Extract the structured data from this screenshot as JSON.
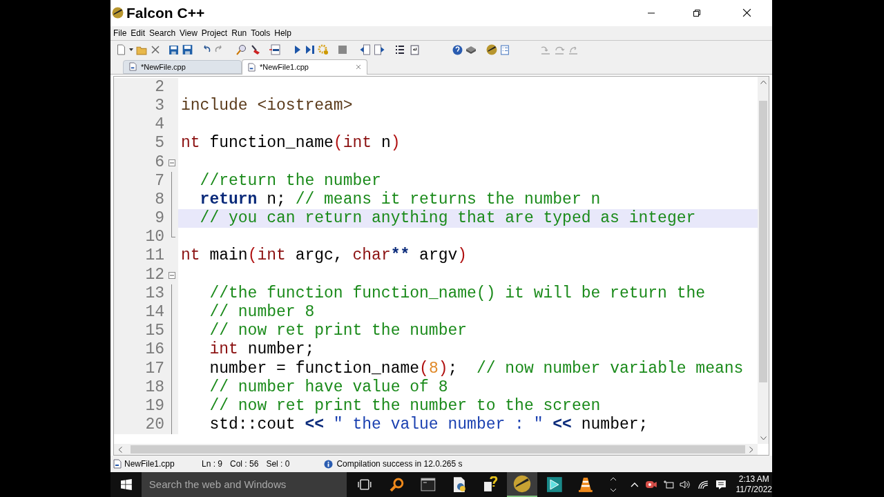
{
  "window": {
    "title": "Falcon C++"
  },
  "menu": [
    "File",
    "Edit",
    "Search",
    "View",
    "Project",
    "Run",
    "Tools",
    "Help"
  ],
  "tabs": [
    {
      "label": "*NewFile.cpp",
      "selected": false
    },
    {
      "label": "*NewFile1.cpp",
      "selected": true
    }
  ],
  "editor": {
    "lines": [
      {
        "number": "2",
        "current": false,
        "kind": "plain"
      },
      {
        "number": "3",
        "current": false,
        "kind": "plain",
        "tokens": [
          {
            "text": "include <iostream>",
            "kind": "preproc"
          }
        ]
      },
      {
        "number": "4",
        "current": false,
        "kind": "plain"
      },
      {
        "number": "5",
        "current": false,
        "kind": "plain",
        "tokens": [
          {
            "text": "nt",
            "kind": "type"
          },
          {
            "text": " function_name",
            "kind": "plain"
          },
          {
            "text": "(",
            "kind": "punct"
          },
          {
            "text": "int",
            "kind": "type"
          },
          {
            "text": " n",
            "kind": "plain"
          },
          {
            "text": ")",
            "kind": "punct"
          }
        ]
      },
      {
        "number": "6",
        "current": false,
        "kind": "fold_start"
      },
      {
        "number": "7",
        "current": false,
        "kind": "fold_body",
        "tokens": [
          {
            "text": "  //return the number",
            "kind": "comment"
          }
        ]
      },
      {
        "number": "8",
        "current": false,
        "kind": "fold_body",
        "tokens": [
          {
            "text": "  return",
            "kind": "keyword"
          },
          {
            "text": " n; ",
            "kind": "plain"
          },
          {
            "text": "// means it returns the number n",
            "kind": "comment"
          }
        ]
      },
      {
        "number": "9",
        "current": true,
        "kind": "fold_body",
        "tokens": [
          {
            "text": "  // you can return anything that are typed as integer",
            "kind": "comment"
          }
        ]
      },
      {
        "number": "10",
        "current": false,
        "kind": "fold_end"
      },
      {
        "number": "11",
        "current": false,
        "kind": "plain",
        "tokens": [
          {
            "text": "nt",
            "kind": "type"
          },
          {
            "text": " main",
            "kind": "plain"
          },
          {
            "text": "(",
            "kind": "punct"
          },
          {
            "text": "int",
            "kind": "type"
          },
          {
            "text": " argc, ",
            "kind": "plain"
          },
          {
            "text": "char",
            "kind": "type"
          },
          {
            "text": "**",
            "kind": "op"
          },
          {
            "text": " argv",
            "kind": "plain"
          },
          {
            "text": ")",
            "kind": "punct"
          }
        ]
      },
      {
        "number": "12",
        "current": false,
        "kind": "fold_start"
      },
      {
        "number": "13",
        "current": false,
        "kind": "fold_body",
        "tokens": [
          {
            "text": "   //the function function_name() it will be return the",
            "kind": "comment"
          }
        ]
      },
      {
        "number": "14",
        "current": false,
        "kind": "fold_body",
        "tokens": [
          {
            "text": "   // number 8",
            "kind": "comment"
          }
        ]
      },
      {
        "number": "15",
        "current": false,
        "kind": "fold_body",
        "tokens": [
          {
            "text": "   // now ret print the number",
            "kind": "comment"
          }
        ]
      },
      {
        "number": "16",
        "current": false,
        "kind": "fold_body",
        "tokens": [
          {
            "text": "   int",
            "kind": "type"
          },
          {
            "text": " number;",
            "kind": "plain"
          }
        ]
      },
      {
        "number": "17",
        "current": false,
        "kind": "fold_body",
        "tokens": [
          {
            "text": "   number = function_name",
            "kind": "plain"
          },
          {
            "text": "(",
            "kind": "punct"
          },
          {
            "text": "8",
            "kind": "number"
          },
          {
            "text": ")",
            "kind": "punct"
          },
          {
            "text": ";  ",
            "kind": "plain"
          },
          {
            "text": "// now number variable means",
            "kind": "comment"
          }
        ]
      },
      {
        "number": "18",
        "current": false,
        "kind": "fold_body",
        "tokens": [
          {
            "text": "   // number have value of 8",
            "kind": "comment"
          }
        ]
      },
      {
        "number": "19",
        "current": false,
        "kind": "fold_body",
        "tokens": [
          {
            "text": "   // now ret print the number to the screen",
            "kind": "comment"
          }
        ]
      },
      {
        "number": "20",
        "current": false,
        "kind": "fold_body",
        "tokens": [
          {
            "text": "   std::cout ",
            "kind": "plain"
          },
          {
            "text": "<<",
            "kind": "op"
          },
          {
            "text": " \" the value number : \" ",
            "kind": "string"
          },
          {
            "text": "<<",
            "kind": "op"
          },
          {
            "text": " number;",
            "kind": "plain"
          }
        ]
      }
    ]
  },
  "status_bar": {
    "file": "NewFile1.cpp",
    "line": "Ln : 9",
    "column": "Col : 56",
    "selection": "Sel : 0",
    "message": "Compilation success in 12.0.265 s"
  },
  "taskbar": {
    "search_placeholder": "Search the web and Windows",
    "time": "2:13 AM",
    "date": "11/7/2022"
  }
}
